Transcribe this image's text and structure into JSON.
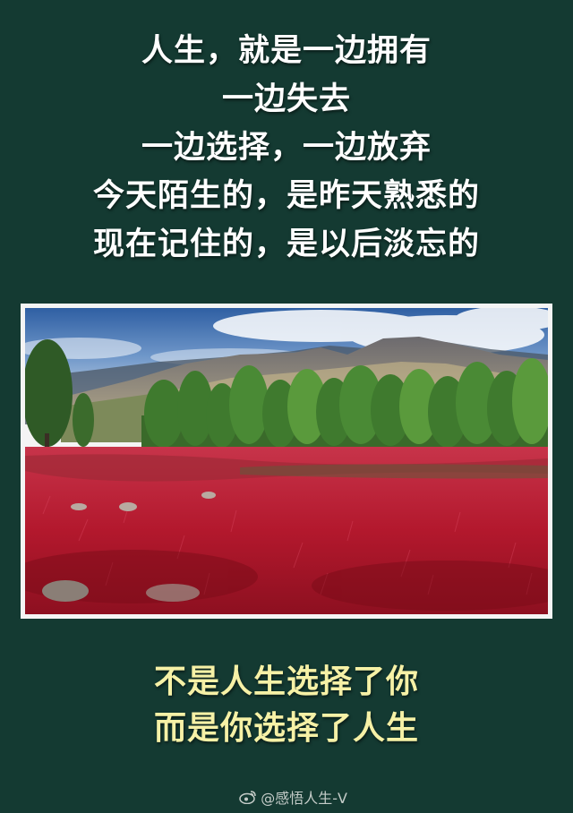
{
  "poem": {
    "lines": [
      "人生，就是一边拥有",
      "一边失去",
      "一边选择，一边放弃",
      "今天陌生的，是昨天熟悉的",
      "现在记住的，是以后淡忘的"
    ]
  },
  "photo": {
    "subject": "red-grass-meadow-with-trees-and-mountains"
  },
  "closing": {
    "lines": [
      "不是人生选择了你",
      "而是你选择了人生"
    ]
  },
  "watermark": {
    "text": "@感悟人生-V",
    "icon": "weibo-icon"
  },
  "colors": {
    "background": "#143a32",
    "poem_text": "#ffffff",
    "closing_text": "#f6f1a6",
    "meadow_red": "#b3182d",
    "sky_blue": "#3f6fb0",
    "tree_green": "#3f7a2e"
  }
}
